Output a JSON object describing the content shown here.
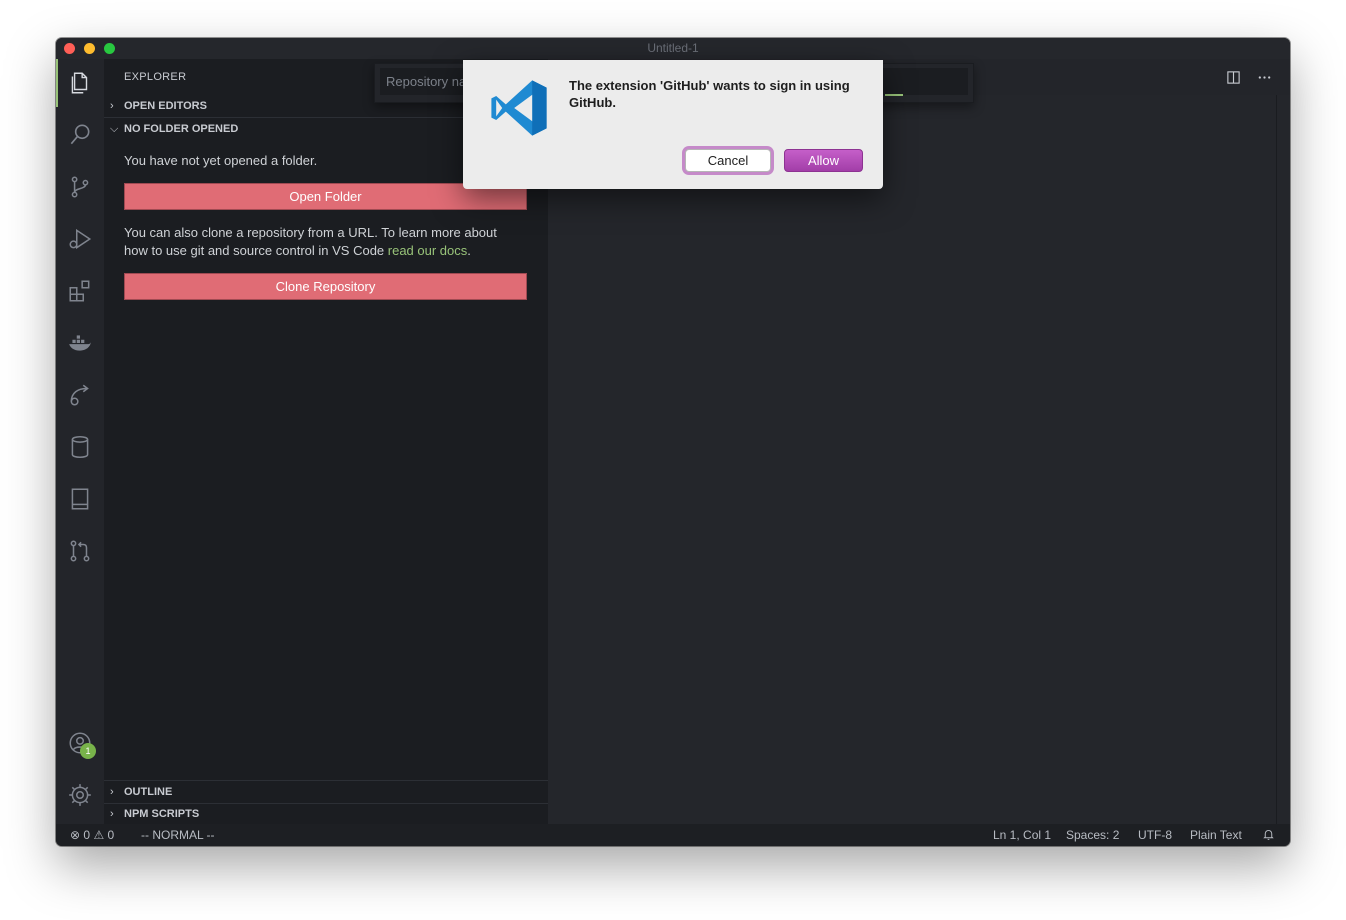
{
  "window": {
    "title": "Untitled-1"
  },
  "activity_bar": {
    "items": [
      "explorer-icon",
      "search-icon",
      "source-control-icon",
      "run-debug-icon",
      "extensions-icon",
      "docker-icon",
      "remote-icon",
      "database-icon",
      "book-icon",
      "pull-request-icon"
    ],
    "account_badge": "1"
  },
  "sidebar": {
    "title": "EXPLORER",
    "sections": {
      "open_editors": "OPEN EDITORS",
      "no_folder": "NO FOLDER OPENED",
      "outline": "OUTLINE",
      "npm_scripts": "NPM SCRIPTS"
    },
    "no_folder_text": "You have not yet opened a folder.",
    "open_folder_button": "Open Folder",
    "clone_text_1": "You can also clone a repository from a URL. To learn more about",
    "clone_text_2": "how to use git and source control in VS Code ",
    "clone_link": "read our docs",
    "clone_text_end": ".",
    "clone_button": "Clone Repository"
  },
  "quick_open": {
    "placeholder": "Repository name"
  },
  "dialog": {
    "message": "The extension 'GitHub' wants to sign in using GitHub.",
    "cancel": "Cancel",
    "allow": "Allow"
  },
  "status_bar": {
    "errors": "0",
    "warnings": "0",
    "mode": "-- NORMAL --",
    "position": "Ln 1, Col 1",
    "spaces": "Spaces: 2",
    "encoding": "UTF-8",
    "language": "Plain Text"
  },
  "colors": {
    "accent_green": "#98c379",
    "button_red": "#e06c75",
    "allow_purple": "#a23ea8",
    "vscode_blue": "#1f8ad2"
  }
}
